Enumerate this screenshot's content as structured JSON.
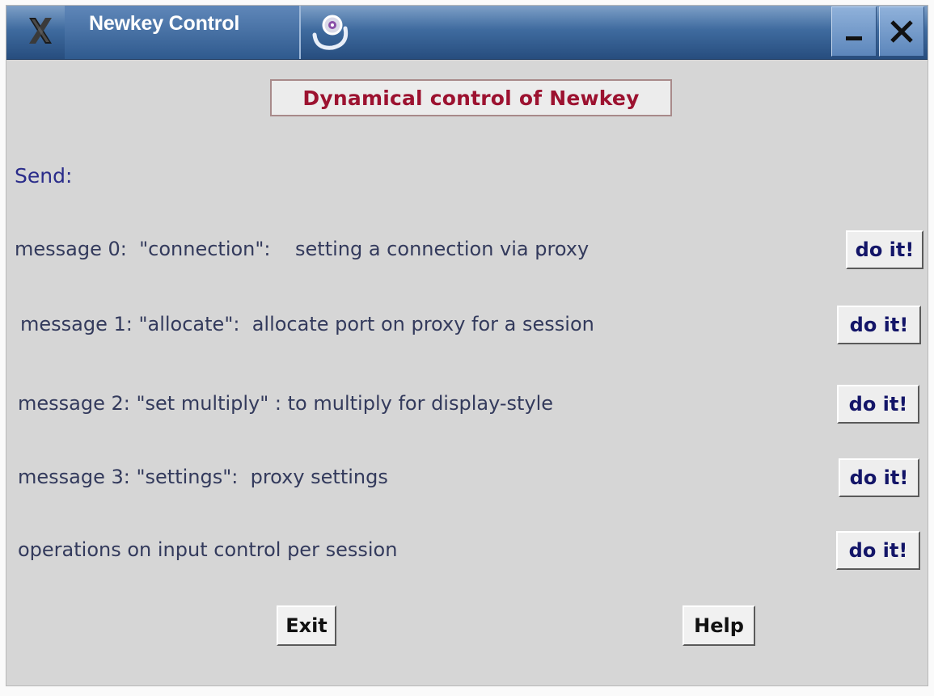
{
  "window": {
    "title": "Newkey Control",
    "heading": "Dynamical control of Newkey",
    "send_label": "Send:"
  },
  "messages": [
    {
      "label": "message 0:  \"connection\":    setting a connection via proxy",
      "button": "do it!"
    },
    {
      "label": "message 1: \"allocate\":  allocate port on proxy for a session",
      "button": "do it!"
    },
    {
      "label": "message 2: \"set multiply\" : to multiply for display-style",
      "button": "do it!"
    },
    {
      "label": "message 3: \"settings\":  proxy settings",
      "button": "do it!"
    },
    {
      "label": "operations on input control per session",
      "button": "do it!"
    }
  ],
  "footer": {
    "exit_label": "Exit",
    "help_label": "Help"
  },
  "icons": {
    "system_menu": "x-logo-icon",
    "title_decoration": "swirl-icon",
    "minimize": "minimize-icon",
    "close": "close-icon"
  },
  "colors": {
    "window_bg": "#d6d6d6",
    "heading_text": "#9c1230",
    "button_text": "#131568",
    "label_text": "#333a5c",
    "titlebar": "#3f6b9f"
  }
}
